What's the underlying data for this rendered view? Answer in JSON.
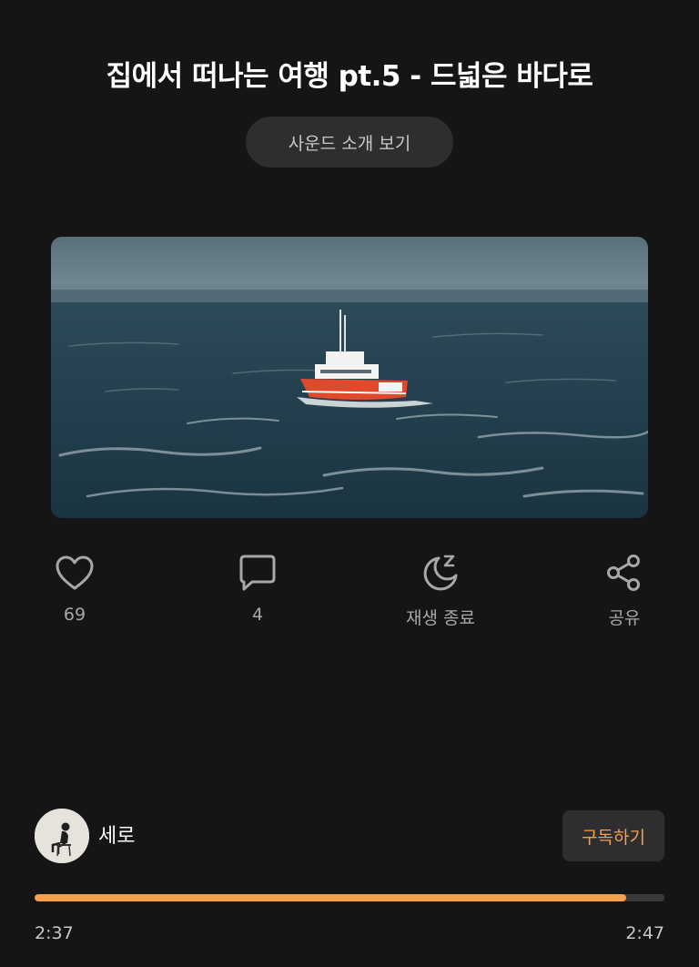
{
  "header": {
    "title": "집에서 떠나는 여행 pt.5 - 드넓은 바다로",
    "intro_button_label": "사운드 소개 보기"
  },
  "actions": [
    {
      "icon": "heart-icon",
      "label": "69"
    },
    {
      "icon": "comment-icon",
      "label": "4"
    },
    {
      "icon": "sleep-timer-icon",
      "label": "재생 종료"
    },
    {
      "icon": "share-icon",
      "label": "공유"
    }
  ],
  "creator": {
    "name": "세로",
    "subscribe_label": "구독하기"
  },
  "player": {
    "current_time": "2:37",
    "total_time": "2:47",
    "progress_percent": 94
  },
  "colors": {
    "accent": "#f5a04a",
    "background": "#151516",
    "button_bg": "#2e2e30"
  }
}
